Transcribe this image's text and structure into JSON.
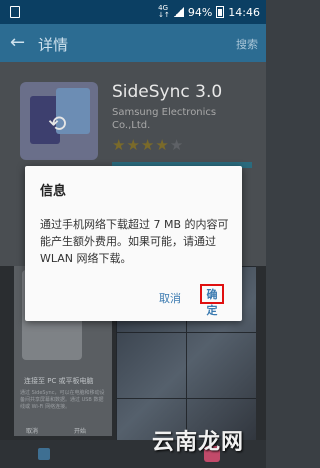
{
  "status_bar": {
    "network": "4G",
    "network_sub": "↓↑",
    "battery": "94%",
    "time": "14:46"
  },
  "app_bar": {
    "back_icon": "arrow-left-icon",
    "title": "详情",
    "search_label": "搜索"
  },
  "app_info": {
    "name": "SideSync 3.0",
    "developer": "Samsung Electronics Co.,Ltd.",
    "rating_stars": 4,
    "max_stars": 5
  },
  "screenshot_caption": {
    "title": "连接至 PC 或平板电脑",
    "body": "通过 SideSync，可以在电脑和移动设备间共享屏幕和数据。通过 USB 数据线或 Wi-Fi 网络连接。",
    "left": "取消",
    "right": "开始"
  },
  "dialog": {
    "title": "信息",
    "message": "通过手机网络下载超过 7 MB 的内容可能产生额外费用。如果可能，请通过 WLAN 网络下载。",
    "cancel_label": "取消",
    "ok_label": "确定",
    "highlight_color": "#e01010"
  },
  "watermark": "云南龙网"
}
